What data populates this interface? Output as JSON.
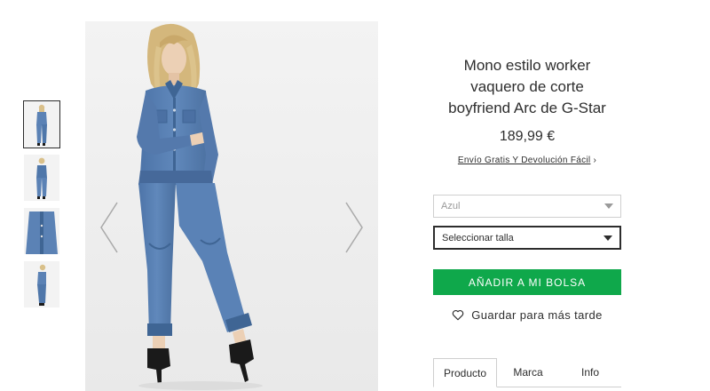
{
  "product": {
    "title_lines": [
      "Mono estilo worker",
      "vaquero de corte",
      "boyfriend Arc de G-Star"
    ],
    "price": "189,99 €",
    "shipping_link": "Envío Gratis Y Devolución Fácil",
    "shipping_chevron": "›"
  },
  "options": {
    "color": "Azul",
    "size_placeholder": "Seleccionar talla"
  },
  "actions": {
    "add_to_bag": "AÑADIR A MI BOLSA",
    "save_for_later": "Guardar para más tarde"
  },
  "tabs": [
    {
      "label": "Producto",
      "active": true
    },
    {
      "label": "Marca",
      "active": false
    },
    {
      "label": "Info",
      "active": false
    }
  ],
  "colors": {
    "accent_green": "#0fa84b",
    "denim": "#5b82b5",
    "denim_dark": "#3f6594",
    "skin": "#e8c6a8",
    "hair": "#d9c08a",
    "shoe": "#1a1a1a"
  },
  "thumbnails": [
    {
      "view": "front",
      "active": true
    },
    {
      "view": "back",
      "active": false
    },
    {
      "view": "close-up",
      "active": false
    },
    {
      "view": "side",
      "active": false
    }
  ]
}
